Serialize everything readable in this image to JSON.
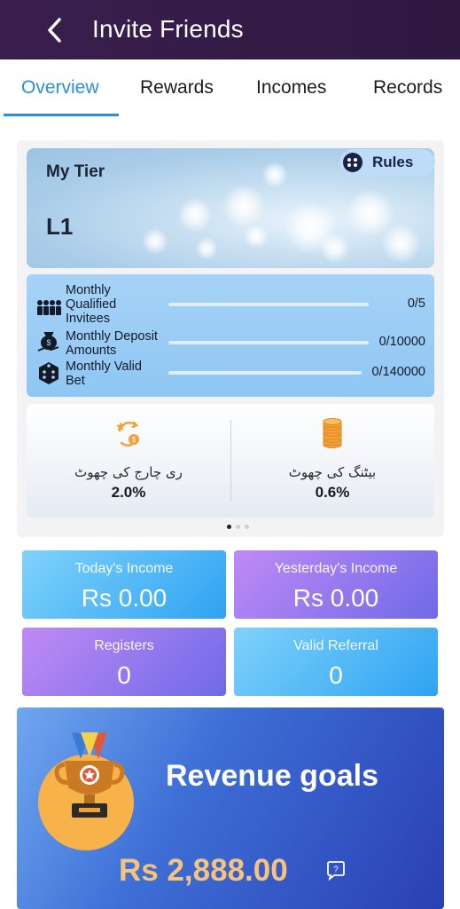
{
  "header": {
    "title": "Invite Friends"
  },
  "tabs": [
    {
      "label": "Overview",
      "active": true
    },
    {
      "label": "Rewards",
      "active": false
    },
    {
      "label": "Incomes",
      "active": false
    },
    {
      "label": "Records",
      "active": false
    }
  ],
  "tier": {
    "heading": "My Tier",
    "level": "L1",
    "rules_label": "Rules"
  },
  "progress": [
    {
      "label": "Monthly Qualified Invitees",
      "value": "0/5",
      "icon": "people-icon"
    },
    {
      "label": "Monthly Deposit Amounts",
      "value": "0/10000",
      "icon": "money-bag-icon"
    },
    {
      "label": "Monthly Valid Bet",
      "value": "0/140000",
      "icon": "dice-icon"
    }
  ],
  "rebates": [
    {
      "name": "ری چارج کی چھوٹ",
      "value": "2.0%",
      "icon": "recharge-rebate-icon"
    },
    {
      "name": "بیٹنگ کی چھوٹ",
      "value": "0.6%",
      "icon": "coin-stack-icon"
    }
  ],
  "stats": {
    "today_label": "Today's Income",
    "today_value": "Rs 0.00",
    "yesterday_label": "Yesterday's Income",
    "yesterday_value": "Rs 0.00",
    "registers_label": "Registers",
    "registers_value": "0",
    "referral_label": "Valid Referral",
    "referral_value": "0"
  },
  "revenue": {
    "title": "Revenue goals",
    "amount": "Rs 2,888.00"
  },
  "colors": {
    "header_bg": "#3a1f4e",
    "accent": "#2a8fd6",
    "stat_blue": "#2fa3f2",
    "stat_purple": "#6f6ae8",
    "revenue_amount": "#f7c27a"
  }
}
